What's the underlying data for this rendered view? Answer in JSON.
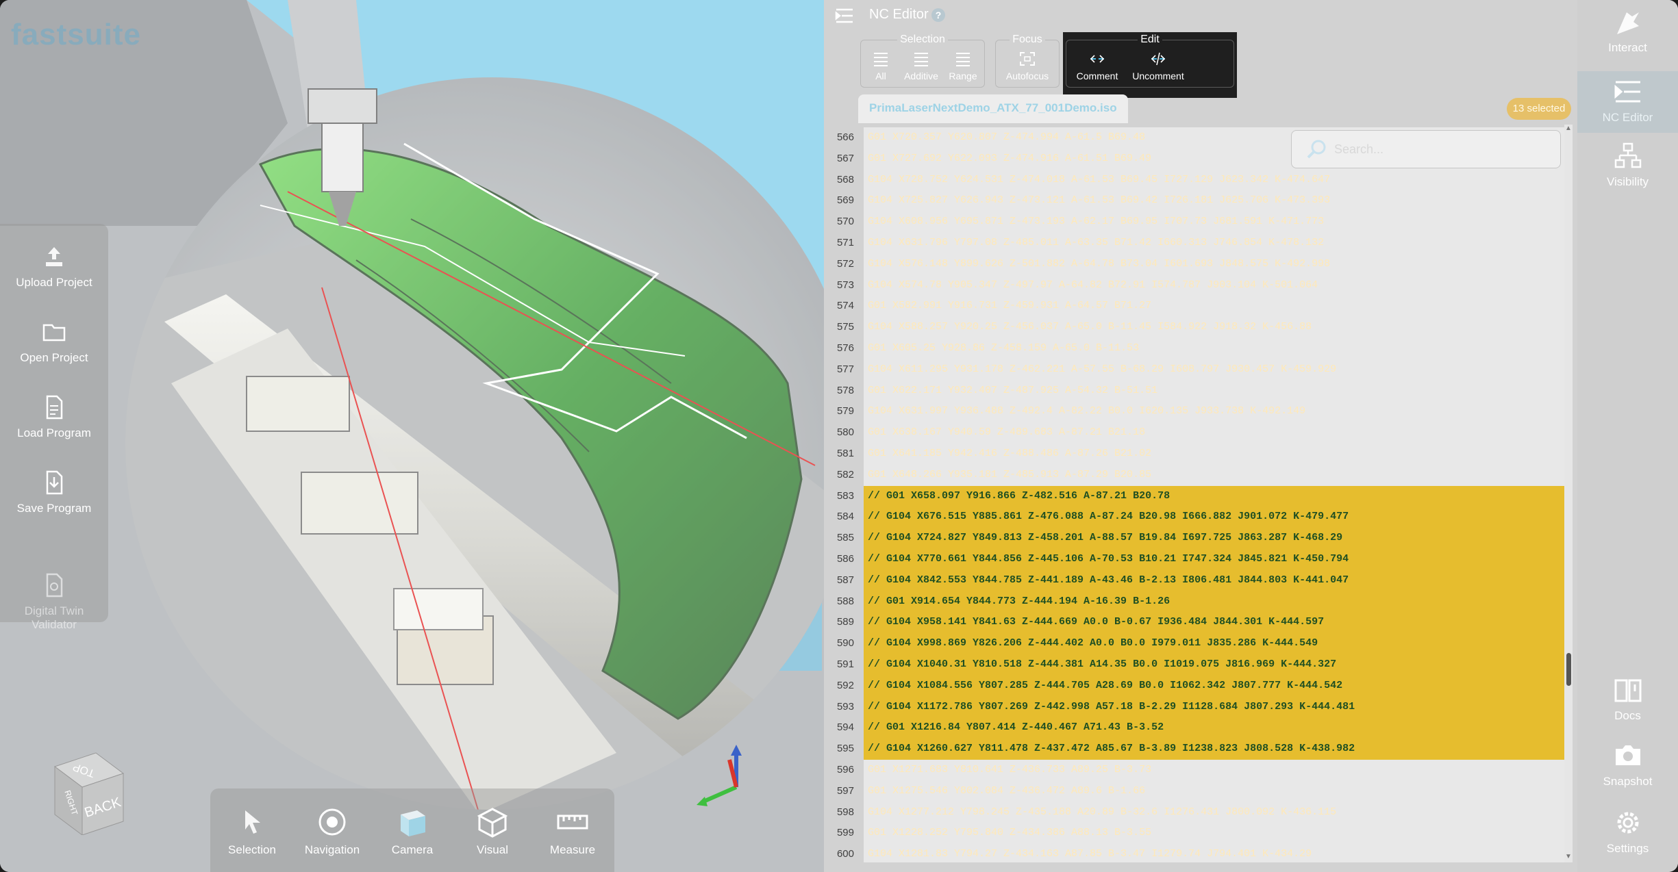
{
  "brand": {
    "logo_text": "fastsuite"
  },
  "left_menu": {
    "items": [
      {
        "label": "Upload Project",
        "icon": "upload-project-icon"
      },
      {
        "label": "Open Project",
        "icon": "open-folder-icon"
      },
      {
        "label": "Load Program",
        "icon": "load-document-icon"
      },
      {
        "label": "Save Program",
        "icon": "save-document-icon"
      },
      {
        "label": "Digital Twin\nValidator",
        "icon": "digital-twin-icon",
        "disabled": true
      }
    ]
  },
  "viewcube": {
    "top": "TOP",
    "front": "BACK",
    "side": "RIGHT"
  },
  "bottom_toolbar": {
    "items": [
      {
        "label": "Selection",
        "icon": "cursor-icon"
      },
      {
        "label": "Navigation",
        "icon": "navigation-icon"
      },
      {
        "label": "Camera",
        "icon": "camera-cube-icon"
      },
      {
        "label": "Visual",
        "icon": "visual-cube-icon"
      },
      {
        "label": "Measure",
        "icon": "ruler-icon"
      }
    ]
  },
  "nc_editor": {
    "title": "NC Editor",
    "help": "?",
    "groups": {
      "selection": {
        "title": "Selection",
        "buttons": [
          "All",
          "Additive",
          "Range"
        ]
      },
      "focus": {
        "title": "Focus",
        "buttons": [
          "Autofocus"
        ]
      },
      "edit": {
        "title": "Edit",
        "buttons": [
          "Comment",
          "Uncomment"
        ]
      }
    },
    "file_tab": "PrimaLaserNextDemo_ATX_77_001Demo.iso",
    "selected_badge": "13 selected",
    "search": {
      "placeholder": "Search..."
    },
    "lines": [
      {
        "n": "566",
        "code": "G01 X720.357 Y620.807 Z-474.994 A-61.5 B69.48",
        "sel": false
      },
      {
        "n": "567",
        "code": "G01 X727.692 Y622.093 Z-474.916 A-61.51 B69.49",
        "sel": false
      },
      {
        "n": "568",
        "code": "G104 X728.752 Y624.531 Z-474.018 A-61.53 B69.45 I727.129 J623.342 K-474.647",
        "sel": false
      },
      {
        "n": "569",
        "code": "G104 X725.827 Y626.943 Z-473.121 A-61.53 B69.42 I726.181 J625.706 K-473.393",
        "sel": false
      },
      {
        "n": "570",
        "code": "G104 X608.956 Y695.871 Z-473.193 A-62.17 B69.95 I707.73 J681.591 K-471.773",
        "sel": false
      },
      {
        "n": "571",
        "code": "G104 X631.796 Y797.08 Z-485.011 A-63.35 B71.42 I660.313 J746.854 K-478.132",
        "sel": false
      },
      {
        "n": "572",
        "code": "G104 X576.148 Y899.626 Z-501.882 A-64.78 B73.04 I601.693 J848.575 K-492.998",
        "sel": false
      },
      {
        "n": "573",
        "code": "G104 X574.78 Y905.347 Z-497.97 A-64.82 B72.91 I574.787 J903.104 K-501.064",
        "sel": false
      },
      {
        "n": "574",
        "code": "G01 X582.991 Y916.731 Z-459.931 A-64.57 B71.27",
        "sel": false
      },
      {
        "n": "575",
        "code": "G104 X588.257 Y920.25 Z-456.037 A-65.0 B-11.45 I584.922 J918.32 K-456.88",
        "sel": false
      },
      {
        "n": "576",
        "code": "G01 X605.25 Y928.86 Z-458.159 A-65.0 B-11.53",
        "sel": false
      },
      {
        "n": "577",
        "code": "G104 X611.295 Y931.178 Z-462.221 A-57.55 B-68.29 I608.797 J930.457 K-459.929",
        "sel": false
      },
      {
        "n": "578",
        "code": "G01 X622.171 Y932.407 Z-487.925 A-54.32 B-51.51",
        "sel": false
      },
      {
        "n": "579",
        "code": "G104 X631.997 Y936.488 Z-492.4 A-82.22 B0.0 I620.135 J933.738 K-492.149",
        "sel": false
      },
      {
        "n": "580",
        "code": "G01 X638.167 Y940.59 Z-489.683 A-87.21 B21.18",
        "sel": false
      },
      {
        "n": "581",
        "code": "G01 X641.185 Y942.416 Z-488.486 A-87.26 B21.02",
        "sel": false
      },
      {
        "n": "582",
        "code": "G01 X648.266 Y935.181 Z-485.913 A-87.29 B20.85",
        "sel": false
      },
      {
        "n": "583",
        "code": "// G01 X658.097 Y916.866 Z-482.516 A-87.21 B20.78",
        "sel": true
      },
      {
        "n": "584",
        "code": "// G104 X676.515 Y885.861 Z-476.088 A-87.24 B20.98 I666.882 J901.072 K-479.477",
        "sel": true
      },
      {
        "n": "585",
        "code": "// G104 X724.827 Y849.813 Z-458.201 A-88.57 B19.84 I697.725 J863.287 K-468.29",
        "sel": true
      },
      {
        "n": "586",
        "code": "// G104 X770.661 Y844.856 Z-445.106 A-70.53 B10.21 I747.324 J845.821 K-450.794",
        "sel": true
      },
      {
        "n": "587",
        "code": "// G104 X842.553 Y844.785 Z-441.189 A-43.46 B-2.13 I806.481 J844.803 K-441.047",
        "sel": true
      },
      {
        "n": "588",
        "code": "// G01 X914.654 Y844.773 Z-444.194 A-16.39 B-1.26",
        "sel": true
      },
      {
        "n": "589",
        "code": "// G104 X958.141 Y841.63 Z-444.669 A0.0 B-0.67 I936.484 J844.301 K-444.597",
        "sel": true
      },
      {
        "n": "590",
        "code": "// G104 X998.869 Y826.206 Z-444.402 A0.0 B0.0 I979.011 J835.286 K-444.549",
        "sel": true
      },
      {
        "n": "591",
        "code": "// G104 X1040.31 Y810.518 Z-444.381 A14.35 B0.0 I1019.075 J816.969 K-444.327",
        "sel": true
      },
      {
        "n": "592",
        "code": "// G104 X1084.556 Y807.285 Z-444.705 A28.69 B0.0 I1062.342 J807.777 K-444.542",
        "sel": true
      },
      {
        "n": "593",
        "code": "// G104 X1172.786 Y807.269 Z-442.998 A57.18 B-2.29 I1128.684 J807.293 K-444.481",
        "sel": true
      },
      {
        "n": "594",
        "code": "// G01 X1216.84 Y807.414 Z-440.467 A71.43 B-3.52",
        "sel": true
      },
      {
        "n": "595",
        "code": "// G104 X1260.627 Y811.478 Z-437.472 A85.67 B-3.89 I1238.823 J808.528 K-438.982",
        "sel": true
      },
      {
        "n": "596",
        "code": "G01 X1271.683 Y810.641 Z-436.733 A89.25 B-3.73",
        "sel": false
      },
      {
        "n": "597",
        "code": "G01 X1275.546 Y802.084 Z-436.472 A89.6 B-1.66",
        "sel": false
      },
      {
        "n": "598",
        "code": "G104 X1277.212 Y798.245 Z-435.188 A20.89 B-32.6 I1276.431 J800.092 K-436.115",
        "sel": false
      },
      {
        "n": "599",
        "code": "G01 X1228.252 Y795.840 Z-434.386 A88.13 B-3.55",
        "sel": false
      },
      {
        "n": "600",
        "code": "G104 X1281.83 Y794.27 Z-434.163 A87.85 B-3.47 I1279.74 J794.401 K-434.29",
        "sel": false
      }
    ]
  },
  "right_rail": {
    "items": [
      {
        "label": "Interact",
        "icon": "interact-icon"
      },
      {
        "label": "NC Editor",
        "icon": "nc-editor-icon",
        "active": true
      },
      {
        "label": "Visibility",
        "icon": "visibility-tree-icon"
      },
      {
        "label": "Docs",
        "icon": "docs-book-icon"
      },
      {
        "label": "Snapshot",
        "icon": "snapshot-camera-icon"
      },
      {
        "label": "Settings",
        "icon": "settings-gear-icon"
      }
    ]
  }
}
